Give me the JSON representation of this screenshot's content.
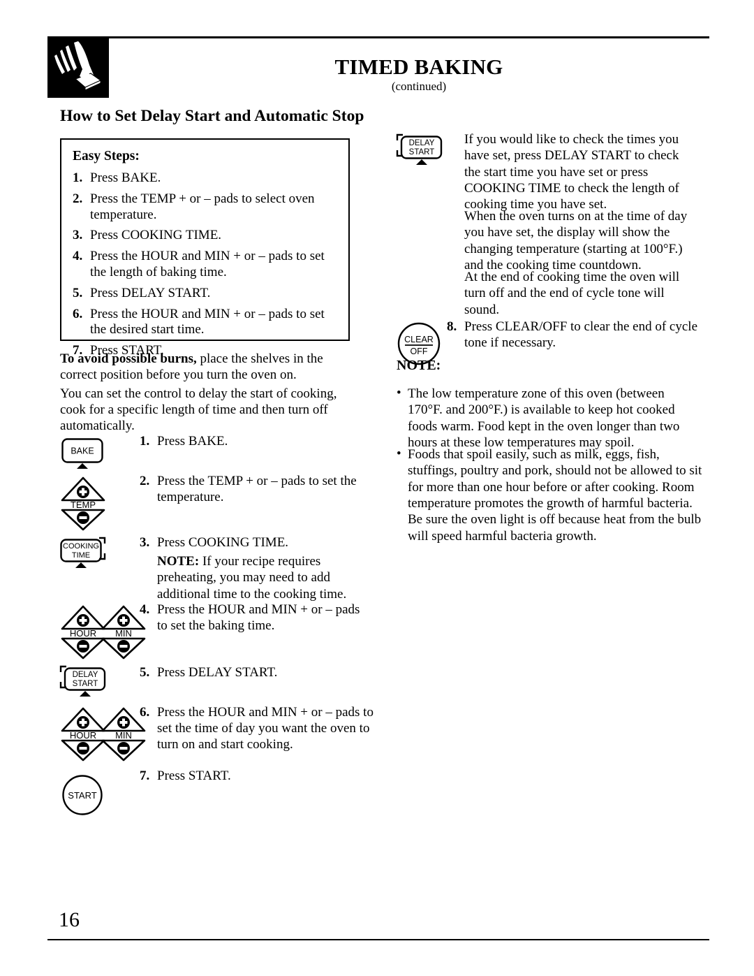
{
  "header": {
    "icon": "hand-pressing-button-icon",
    "title": "TIMED BAKING",
    "subtitle": "(continued)",
    "section_title": "How to Set Delay Start and Automatic Stop"
  },
  "easy_steps": {
    "heading": "Easy Steps:",
    "items": [
      {
        "num": "1.",
        "text": "Press BAKE."
      },
      {
        "num": "2.",
        "text": "Press the TEMP + or – pads to select oven temperature."
      },
      {
        "num": "3.",
        "text": "Press COOKING TIME."
      },
      {
        "num": "4.",
        "text": "Press the HOUR and MIN + or – pads to set the length of baking time."
      },
      {
        "num": "5.",
        "text": "Press DELAY START."
      },
      {
        "num": "6.",
        "text": "Press the HOUR and MIN + or – pads to set the desired start time."
      },
      {
        "num": "7.",
        "text": "Press START."
      }
    ]
  },
  "warning": {
    "bold_lead": "To avoid possible burns,",
    "rest": " place the shelves in the correct position before you turn the oven on."
  },
  "intro": "You can set the control to delay the start of cooking, cook for a specific length of time and then turn off automatically.",
  "instructions": [
    {
      "num": "1.",
      "text": "Press BAKE.",
      "pad": "BAKE"
    },
    {
      "num": "2.",
      "text": "Press the TEMP + or – pads to set the temperature.",
      "pad": "TEMP"
    },
    {
      "num": "3.",
      "text": "Press COOKING TIME.",
      "pad": "COOKING TIME",
      "note_bold": "NOTE:",
      "note_rest": " If your recipe requires preheating, you may need to add additional time to the cooking time."
    },
    {
      "num": "4.",
      "text": "Press the HOUR and MIN + or – pads to set the baking time.",
      "pad": "HOUR/MIN"
    },
    {
      "num": "5.",
      "text": "Press DELAY START.",
      "pad": "DELAY START"
    },
    {
      "num": "6.",
      "text": "Press the HOUR and MIN + or – pads to set the time of day you want the oven to turn on and start cooking.",
      "pad": "HOUR/MIN"
    },
    {
      "num": "7.",
      "text": "Press START.",
      "pad": "START"
    }
  ],
  "pads": {
    "bake": "BAKE",
    "temp": "TEMP",
    "cooking_time_line1": "COOKING",
    "cooking_time_line2": "TIME",
    "hour": "HOUR",
    "min": "MIN",
    "delay_line1": "DELAY",
    "delay_line2": "START",
    "start": "START",
    "clear_line1": "CLEAR",
    "clear_line2": "OFF"
  },
  "right_column": {
    "para1": "If you would like to check the times you have set, press DELAY START to check the start time you have set or press COOKING TIME to check the length of cooking time you have set.",
    "para2": "When the oven turns on at the time of day you have set, the display will show the changing temperature (starting at 100°F.) and the cooking time countdown.",
    "para3": "At the end of cooking time the oven will turn off and the end of cycle tone will sound.",
    "step8_num": "8.",
    "step8_text": "Press CLEAR/OFF to clear the end of cycle tone if necessary.",
    "note_heading": "NOTE:",
    "note_bullets": [
      "The low temperature zone of this oven (between 170°F. and 200°F.) is available to keep hot cooked foods warm. Food kept in the oven longer than two hours at these low temperatures may spoil.",
      "Foods that spoil easily, such as milk, eggs, fish, stuffings, poultry and pork, should not be allowed to sit for more than one hour before or after cooking. Room temperature promotes the growth of harmful bacteria. Be sure the oven light is off because heat from the bulb will speed harmful bacteria growth."
    ]
  },
  "footer": {
    "page_number": "16"
  }
}
